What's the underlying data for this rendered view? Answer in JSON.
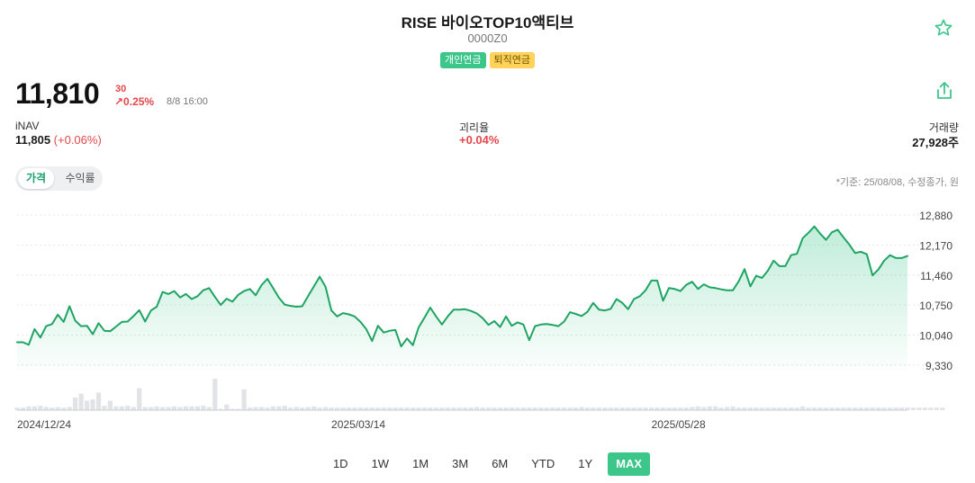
{
  "header": {
    "title": "RISE 바이오TOP10액티브",
    "code": "0000Z0",
    "badges": [
      {
        "label": "개인연금",
        "color": "#3cc68a"
      },
      {
        "label": "퇴직연금",
        "color": "#ffd25a"
      }
    ],
    "favorite_icon": "star-outline-icon",
    "share_icon": "share-icon"
  },
  "quote": {
    "price": "11,810",
    "change_abs": "30",
    "change_pct": "↗0.25%",
    "timestamp": "8/8 16:00"
  },
  "stats": {
    "inav_label": "iNAV",
    "inav_value": "11,805",
    "inav_change": "(+0.06%)",
    "deviation_label": "괴리율",
    "deviation_value": "+0.04%",
    "volume_label": "거래량",
    "volume_value": "27,928주"
  },
  "toggle": {
    "price_label": "가격",
    "return_label": "수익률",
    "active": "price"
  },
  "basis_note": "*기준: 25/08/08, 수정종가, 원",
  "colors": {
    "accent": "#3cc68a",
    "line": "#1fa463",
    "up": "#e4474b",
    "volume": "#e1e3e7"
  },
  "chart_data": {
    "type": "area",
    "y_ticks": [
      "12,880",
      "12,170",
      "11,460",
      "10,750",
      "10,040",
      "9,330"
    ],
    "y_tick_values": [
      12880,
      12170,
      11460,
      10750,
      10040,
      9330
    ],
    "ylim": [
      9200,
      13050
    ],
    "x_tick_labels": [
      "2024/12/24",
      "2025/03/14",
      "2025/05/28"
    ],
    "x_tick_index": [
      0,
      54,
      109
    ],
    "grid": true,
    "legend": "none",
    "series": [
      {
        "values": [
          9870,
          9870,
          9810,
          10180,
          9980,
          10250,
          10300,
          10520,
          10350,
          10720,
          10380,
          10250,
          10260,
          10060,
          10320,
          10140,
          10130,
          10240,
          10350,
          10360,
          10490,
          10630,
          10360,
          10620,
          10710,
          11060,
          11010,
          11080,
          10930,
          11010,
          10890,
          10960,
          11100,
          11150,
          10940,
          10750,
          10900,
          10830,
          10990,
          11080,
          11130,
          10980,
          11220,
          11370,
          11150,
          10920,
          10760,
          10730,
          10710,
          10720,
          10960,
          11190,
          11420,
          11180,
          10620,
          10480,
          10560,
          10530,
          10480,
          10350,
          10180,
          9900,
          10260,
          10100,
          10140,
          10160,
          9770,
          9960,
          9800,
          10220,
          10450,
          10690,
          10480,
          10290,
          10480,
          10640,
          10640,
          10650,
          10610,
          10550,
          10440,
          10280,
          10370,
          10230,
          10480,
          10260,
          10340,
          10290,
          9920,
          10250,
          10290,
          10300,
          10280,
          10250,
          10360,
          10580,
          10540,
          10490,
          10590,
          10800,
          10640,
          10620,
          10660,
          10890,
          10800,
          10650,
          10890,
          10960,
          11100,
          11330,
          11330,
          10850,
          11150,
          11130,
          11080,
          11230,
          11300,
          11130,
          11240,
          11170,
          11150,
          11120,
          11100,
          11100,
          11310,
          11600,
          11190,
          11440,
          11390,
          11560,
          11800,
          11670,
          11670,
          11930,
          11960,
          12330,
          12460,
          12610,
          12440,
          12290,
          12470,
          12530,
          12350,
          12180,
          11980,
          12010,
          11950,
          11450,
          11590,
          11800,
          11930,
          11860,
          11860,
          11910
        ]
      }
    ],
    "volume": [
      40,
      40,
      60,
      60,
      70,
      50,
      40,
      50,
      40,
      50,
      200,
      260,
      150,
      170,
      280,
      70,
      150,
      60,
      60,
      70,
      50,
      350,
      50,
      50,
      60,
      50,
      50,
      60,
      50,
      60,
      60,
      60,
      70,
      50,
      500,
      20,
      90,
      20,
      20,
      330,
      40,
      50,
      50,
      40,
      60,
      60,
      70,
      40,
      50,
      40,
      50,
      60,
      40,
      50,
      40,
      40,
      40,
      40,
      40,
      40,
      40,
      40,
      40,
      40,
      40,
      40,
      40,
      40,
      40,
      40,
      40,
      40,
      40,
      40,
      40,
      40,
      40,
      40,
      40,
      50,
      40,
      40,
      40,
      40,
      40,
      40,
      40,
      40,
      40,
      40,
      40,
      40,
      40,
      40,
      40,
      40,
      40,
      50,
      40,
      40,
      40,
      40,
      40,
      40,
      40,
      40,
      40,
      40,
      40,
      40,
      40,
      40,
      40,
      40,
      40,
      40,
      50,
      60,
      50,
      60,
      60,
      40,
      50,
      60,
      40,
      40,
      40,
      40,
      40,
      40,
      40,
      40,
      40,
      40,
      40,
      60,
      40,
      40,
      40,
      40,
      40,
      40,
      40,
      40,
      40,
      40,
      40,
      40,
      40,
      40,
      40,
      40,
      40,
      40,
      40,
      40,
      40,
      40,
      40,
      40
    ]
  },
  "ranges": [
    "1D",
    "1W",
    "1M",
    "3M",
    "6M",
    "YTD",
    "1Y",
    "MAX"
  ],
  "active_range": "MAX"
}
